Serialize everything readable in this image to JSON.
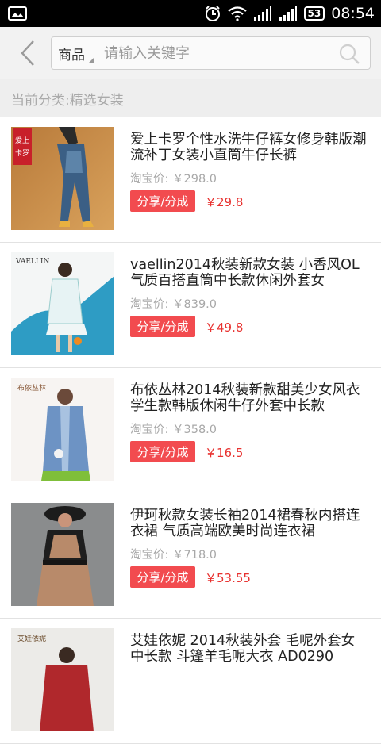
{
  "status_bar": {
    "time": "08:54",
    "battery": "53"
  },
  "search": {
    "category": "商品",
    "placeholder": "请输入关键字"
  },
  "current_category": "当前分类:精选女装",
  "products": [
    {
      "title": "爱上卡罗个性水洗牛仔裤女修身韩版潮流补丁女装小直筒牛仔长裤",
      "taobao_price": "淘宝价: ￥298.0",
      "share_label": "分享/分成",
      "commission": "￥29.8",
      "image_text": "爱上卡罗",
      "image_icon": "jeans-photo"
    },
    {
      "title": "vaellin2014秋装新款女装 小香风OL气质百搭直筒中长款休闲外套女",
      "taobao_price": "淘宝价: ￥839.0",
      "share_label": "分享/分成",
      "commission": "￥49.8",
      "image_text": "VAELLIN",
      "image_icon": "coat-photo"
    },
    {
      "title": "布依丛林2014秋装新款甜美少女风衣学生款韩版休闲牛仔外套中长款",
      "taobao_price": "淘宝价: ￥358.0",
      "share_label": "分享/分成",
      "commission": "￥16.5",
      "image_text": "布依丛林",
      "image_icon": "denim-coat-photo"
    },
    {
      "title": "伊珂秋款女装长袖2014裙春秋内搭连衣裙 气质高端欧美时尚连衣裙",
      "taobao_price": "淘宝价: ￥718.0",
      "share_label": "分享/分成",
      "commission": "￥53.55",
      "image_text": "",
      "image_icon": "dress-photo"
    },
    {
      "title": "艾娃依妮 2014秋装外套 毛呢外套女中长款 斗篷羊毛呢大衣 AD0290",
      "taobao_price": "",
      "share_label": "",
      "commission": "",
      "image_text": "艾娃依妮",
      "image_icon": "wool-coat-photo"
    }
  ]
}
